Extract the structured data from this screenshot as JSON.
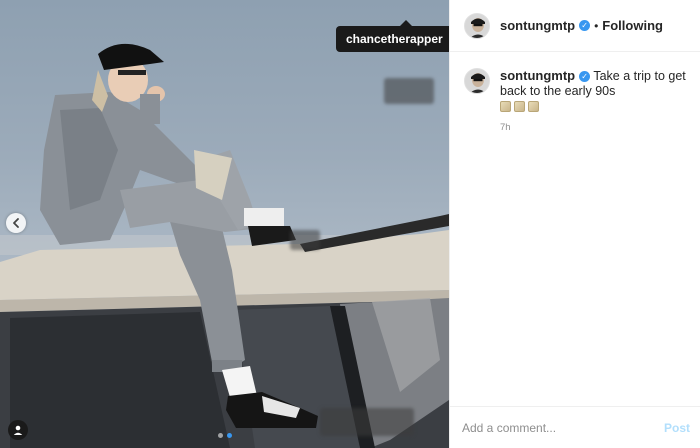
{
  "post": {
    "tagged_user": "chancetherapper",
    "carousel": {
      "count": 2,
      "active_index": 1
    }
  },
  "header": {
    "username": "sontungmtp",
    "follow_state": "Following",
    "separator": "•"
  },
  "caption": {
    "username": "sontungmtp",
    "text": "Take a trip to get back to the early 90s",
    "emoji_count": 3,
    "timestamp": "7h"
  },
  "comment_box": {
    "placeholder": "Add a comment...",
    "post_label": "Post"
  },
  "colors": {
    "verified": "#3897f0",
    "post_disabled": "#b2dffc",
    "muted_text": "#8e8e8e"
  }
}
